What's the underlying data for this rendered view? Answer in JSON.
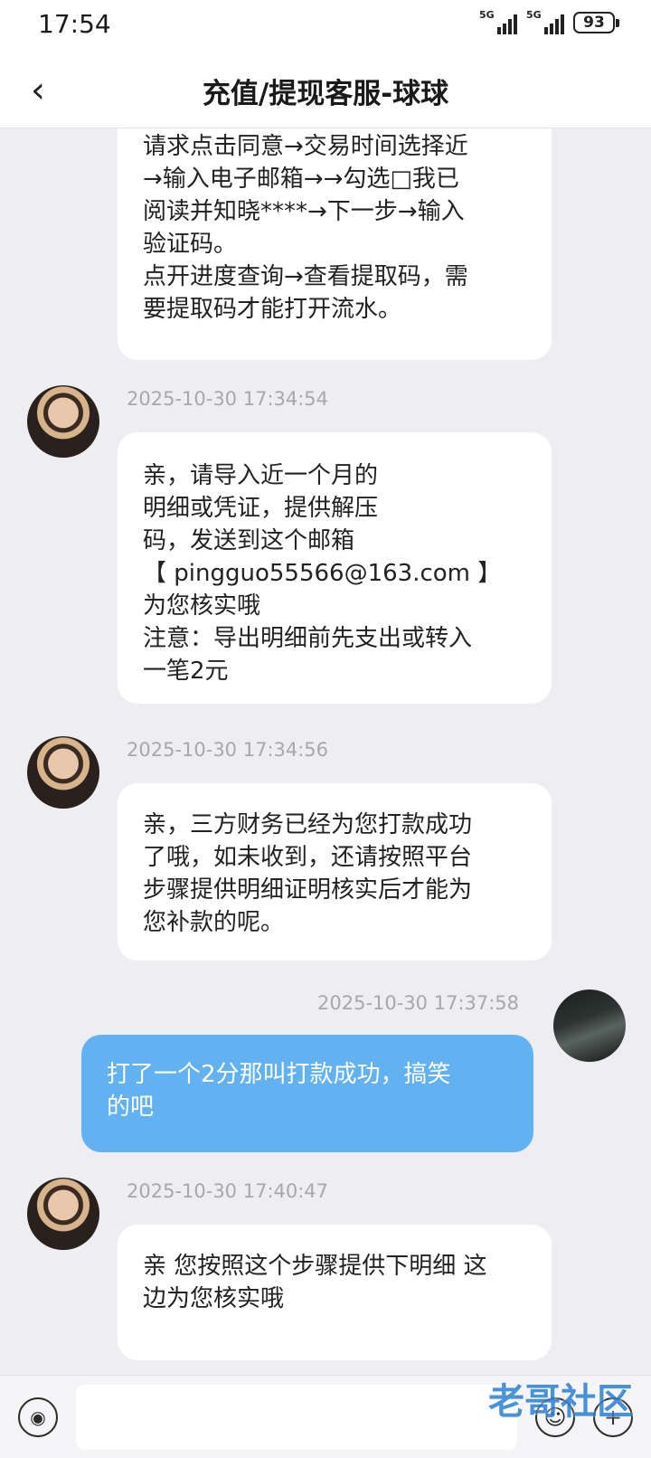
{
  "status_bar": {
    "time": "17:54",
    "signal_1": "5G",
    "signal_2": "5G",
    "battery": "93"
  },
  "header": {
    "title": "充值/提现客服-球球"
  },
  "messages": [
    {
      "text": "请求点击同意→交易时间选择近\n→输入电子邮箱→→勾选□我已\n阅读并知晓****→下一步→输入\n验证码。\n点开进度查询→查看提取码，需\n要提取码才能打开流水。"
    },
    {
      "time": "2025-10-30 17:34:54",
      "text": "亲，请导入近一个月的\n明细或凭证，提供解压\n码，发送到这个邮箱\n【 pingguo55566@163.com  】\n为您核实哦\n注意：导出明细前先支出或转入\n一笔2元"
    },
    {
      "time": "2025-10-30 17:34:56",
      "text": "亲，三方财务已经为您打款成功\n了哦，如未收到，还请按照平台\n步骤提供明细证明核实后才能为\n您补款的呢。"
    },
    {
      "time": "2025-10-30 17:37:58",
      "text": "打了一个2分那叫打款成功，搞笑\n的吧"
    },
    {
      "time": "2025-10-30 17:40:47",
      "text": "亲 您按照这个步骤提供下明细 这\n边为您核实哦"
    }
  ],
  "composer": {
    "placeholder": ""
  },
  "watermark": {
    "text": "老哥社区"
  },
  "colors": {
    "my_bubble": "#62b2f2",
    "chat_bg": "#eeeef2"
  }
}
